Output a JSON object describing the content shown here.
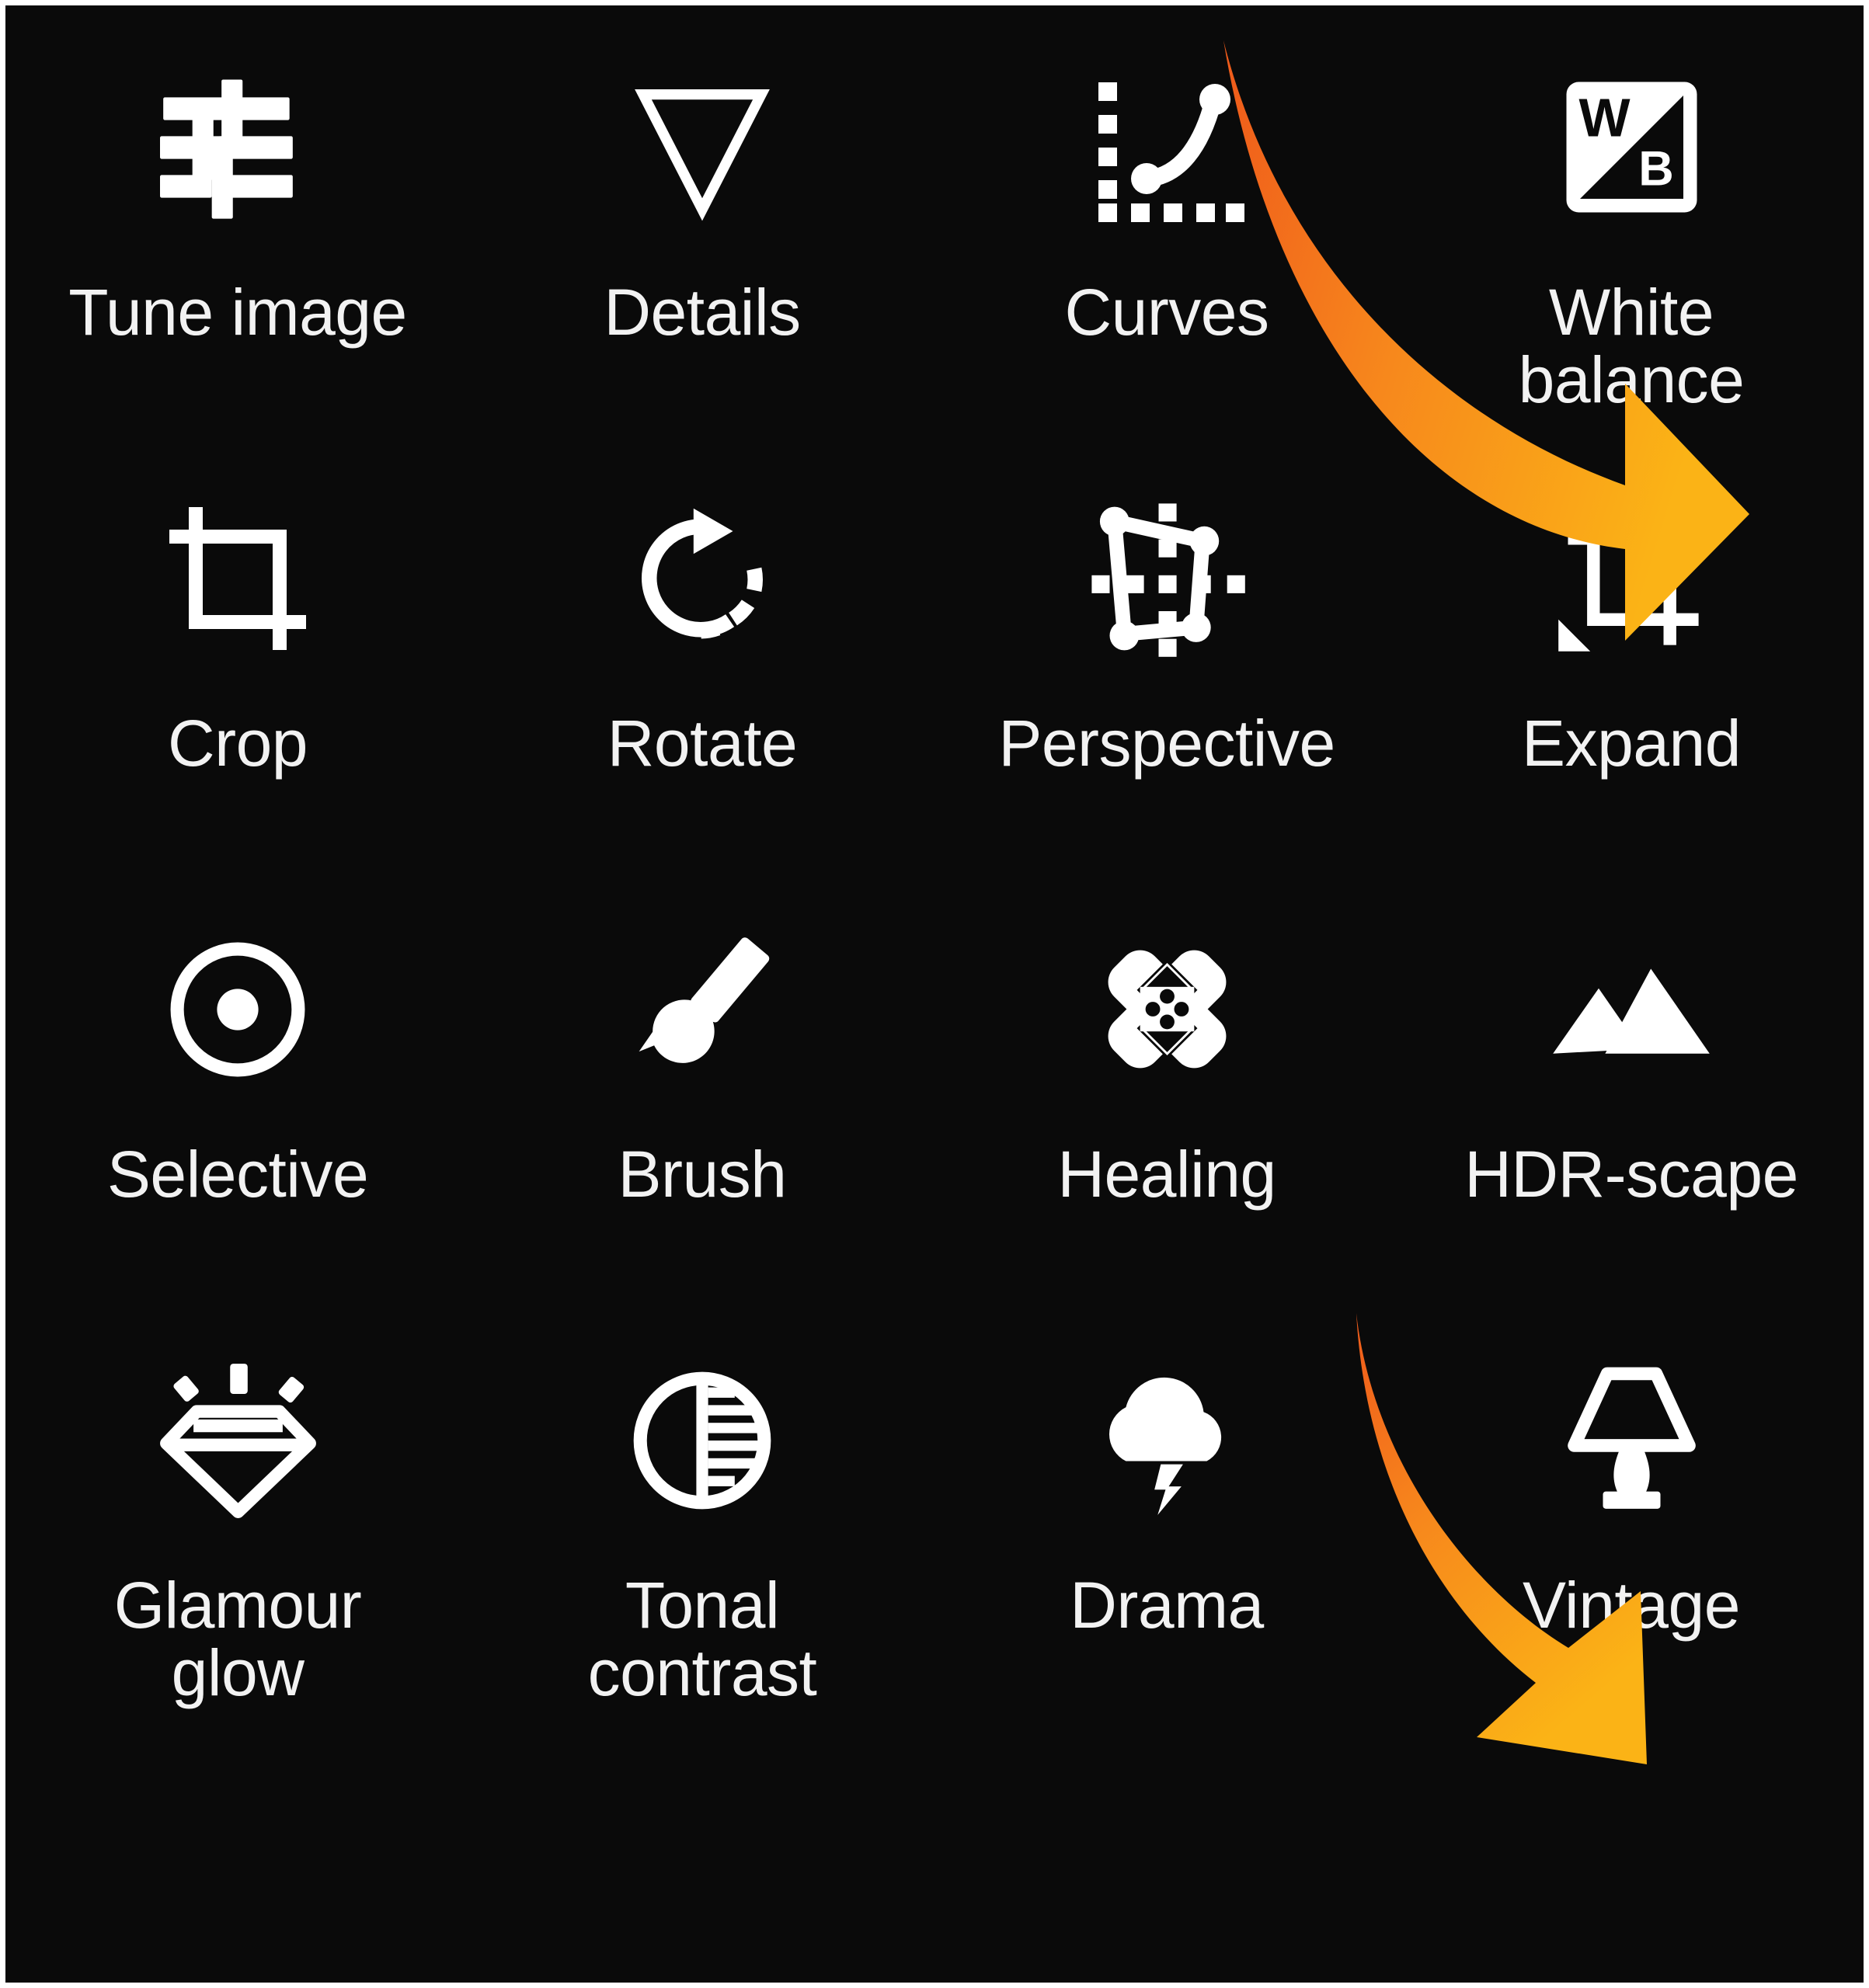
{
  "app": {
    "screen_name": "Photo editor tools grid",
    "background_color": "#0a0a0a",
    "frame_color": "#ffffff",
    "label_color": "#f2f2f2",
    "icon_color": "#ffffff"
  },
  "annotations": {
    "arrow_gradient_start": "#F05A1E",
    "arrow_gradient_end": "#FBB316",
    "items": [
      {
        "name": "arrow-to-white-balance",
        "points_to": "White balance"
      },
      {
        "name": "arrow-to-vintage",
        "points_to": "Vintage"
      }
    ]
  },
  "grid": {
    "columns": 4,
    "rows": 4,
    "tools": [
      {
        "id": "tune-image",
        "label": "Tune image",
        "icon": "sliders-icon"
      },
      {
        "id": "details",
        "label": "Details",
        "icon": "triangle-down-icon"
      },
      {
        "id": "curves",
        "label": "Curves",
        "icon": "curves-icon"
      },
      {
        "id": "white-balance",
        "label": "White\nbalance",
        "icon": "white-balance-icon"
      },
      {
        "id": "crop",
        "label": "Crop",
        "icon": "crop-icon"
      },
      {
        "id": "rotate",
        "label": "Rotate",
        "icon": "rotate-icon"
      },
      {
        "id": "perspective",
        "label": "Perspective",
        "icon": "perspective-icon"
      },
      {
        "id": "expand",
        "label": "Expand",
        "icon": "expand-icon"
      },
      {
        "id": "selective",
        "label": "Selective",
        "icon": "target-dot-icon"
      },
      {
        "id": "brush",
        "label": "Brush",
        "icon": "brush-icon"
      },
      {
        "id": "healing",
        "label": "Healing",
        "icon": "bandage-cross-icon"
      },
      {
        "id": "hdr-scape",
        "label": "HDR-scape",
        "icon": "mountains-icon"
      },
      {
        "id": "glamour-glow",
        "label": "Glamour\nglow",
        "icon": "gem-sparkle-icon"
      },
      {
        "id": "tonal-contrast",
        "label": "Tonal\ncontrast",
        "icon": "contrast-circle-icon"
      },
      {
        "id": "drama",
        "label": "Drama",
        "icon": "cloud-lightning-icon"
      },
      {
        "id": "vintage",
        "label": "Vintage",
        "icon": "table-lamp-icon"
      }
    ]
  },
  "white_balance_icon": {
    "top_letter": "W",
    "bottom_letter": "B"
  }
}
